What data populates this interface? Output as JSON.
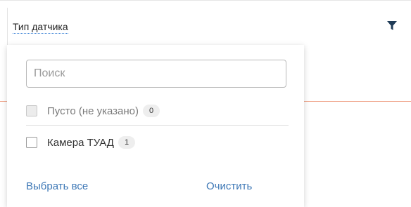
{
  "header": {
    "column_title": "Тип датчика",
    "filter_icon": "filter-icon"
  },
  "dropdown": {
    "search": {
      "placeholder": "Поиск",
      "value": ""
    },
    "options": [
      {
        "label": "Пусто (не указано)",
        "count": "0",
        "disabled": true,
        "checked": false
      },
      {
        "label": "Камера ТУАД",
        "count": "1",
        "disabled": false,
        "checked": false
      }
    ],
    "select_all_label": "Выбрать все",
    "clear_label": "Очистить"
  },
  "colors": {
    "link": "#3e78b6",
    "title_underline": "#1e6fd0",
    "accent_line": "#f0a58a",
    "filter_icon": "#1f3b57"
  }
}
